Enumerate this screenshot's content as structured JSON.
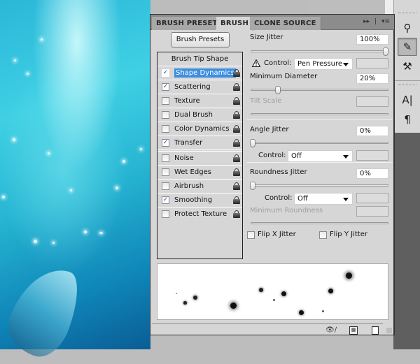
{
  "canvas": {
    "description": "underwater blue document image"
  },
  "panel": {
    "tabs": [
      {
        "label": "BRUSH PRESETS",
        "active": false
      },
      {
        "label": "BRUSH",
        "active": true
      },
      {
        "label": "CLONE SOURCE",
        "active": false
      }
    ],
    "tab_tools": {
      "collapse_icon": "double-right-arrow-icon",
      "menu_icon": "panel-menu-icon"
    },
    "brush_presets_button": "Brush Presets",
    "list": {
      "header": "Brush Tip Shape",
      "items": [
        {
          "label": "Shape Dynamics",
          "checked": true,
          "selected": true
        },
        {
          "label": "Scattering",
          "checked": true,
          "selected": false
        },
        {
          "label": "Texture",
          "checked": false,
          "selected": false
        },
        {
          "label": "Dual Brush",
          "checked": false,
          "selected": false
        },
        {
          "label": "Color Dynamics",
          "checked": false,
          "selected": false
        },
        {
          "label": "Transfer",
          "checked": true,
          "selected": false
        }
      ],
      "items2": [
        {
          "label": "Noise",
          "checked": false
        },
        {
          "label": "Wet Edges",
          "checked": false
        },
        {
          "label": "Airbrush",
          "checked": false
        },
        {
          "label": "Smoothing",
          "checked": true
        },
        {
          "label": "Protect Texture",
          "checked": false
        }
      ]
    },
    "settings": {
      "size_jitter": {
        "label": "Size Jitter",
        "value": "100%",
        "slider_fraction": 1.0
      },
      "size_control": {
        "label": "Control:",
        "value": "Pen Pressure",
        "warning": true
      },
      "minimum_diameter": {
        "label": "Minimum Diameter",
        "value": "20%",
        "slider_fraction": 0.2
      },
      "tilt_scale": {
        "label": "Tilt Scale",
        "value": "",
        "disabled": true
      },
      "angle_jitter": {
        "label": "Angle Jitter",
        "value": "0%",
        "slider_fraction": 0
      },
      "angle_control": {
        "label": "Control:",
        "value": "Off"
      },
      "roundness_jitter": {
        "label": "Roundness Jitter",
        "value": "0%",
        "slider_fraction": 0
      },
      "roundness_control": {
        "label": "Control:",
        "value": "Off"
      },
      "minimum_roundness": {
        "label": "Minimum Roundness",
        "value": "",
        "disabled": true
      },
      "flip_x": {
        "label": "Flip X Jitter",
        "checked": false
      },
      "flip_y": {
        "label": "Flip Y Jitter",
        "checked": false
      }
    },
    "footer": {
      "icons": [
        "toggle-live-tip-preview-icon",
        "brush-panel-grid-icon",
        "create-new-brush-icon"
      ]
    },
    "check_glyph": "✓"
  },
  "dock": {
    "buttons": [
      {
        "icon": "brush-presets-icon",
        "glyph": "⚲",
        "active": false
      },
      {
        "icon": "brush-icon",
        "glyph": "✎",
        "active": true
      },
      {
        "icon": "clone-source-icon",
        "glyph": "⚒",
        "active": false
      },
      {
        "icon": "character-icon",
        "glyph": "A|",
        "active": false
      },
      {
        "icon": "paragraph-icon",
        "glyph": "¶",
        "active": false
      }
    ]
  }
}
